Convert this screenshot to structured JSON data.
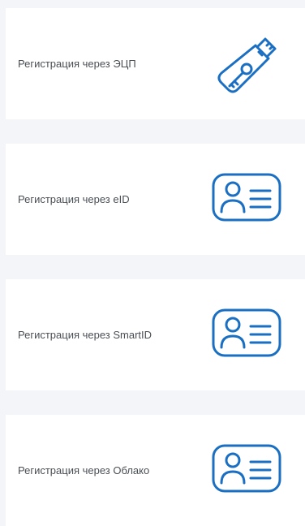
{
  "accent_color": "#1a6fc2",
  "options": [
    {
      "label": "Регистрация через ЭЦП",
      "icon": "usb-key-icon"
    },
    {
      "label": "Регистрация через eID",
      "icon": "id-card-icon"
    },
    {
      "label": "Регистрация через SmartID",
      "icon": "id-card-icon"
    },
    {
      "label": "Регистрация через Облако",
      "icon": "id-card-icon"
    }
  ]
}
